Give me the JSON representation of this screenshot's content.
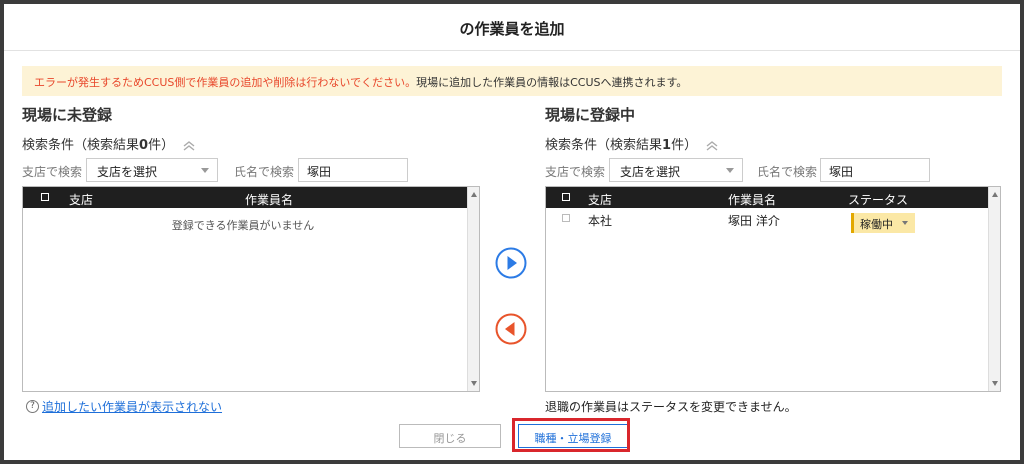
{
  "modal": {
    "title": "の作業員を追加",
    "warning_red": "エラーが発生するためCCUS側で作業員の追加や削除は行わないでください。",
    "warning_normal": "現場に追加した作業員の情報はCCUSへ連携されます。"
  },
  "left": {
    "title": "現場に未登録",
    "condition_prefix": "検索条件（検索結果",
    "condition_count": "0",
    "condition_suffix": "件）",
    "branch_label": "支店で検索",
    "branch_select": "支店を選択",
    "name_label": "氏名で検索",
    "name_value": "塚田",
    "columns": {
      "branch": "支店",
      "worker": "作業員名"
    },
    "empty_message": "登録できる作業員がいません",
    "help_link": "追加したい作業員が表示されない"
  },
  "right": {
    "title": "現場に登録中",
    "condition_prefix": "検索条件（検索結果",
    "condition_count": "1",
    "condition_suffix": "件）",
    "branch_label": "支店で検索",
    "branch_select": "支店を選択",
    "name_label": "氏名で検索",
    "name_value": "塚田",
    "columns": {
      "branch": "支店",
      "worker": "作業員名",
      "status": "ステータス"
    },
    "rows": [
      {
        "branch": "本社",
        "worker": "塚田 洋介",
        "status": "稼働中"
      }
    ],
    "note": "退職の作業員はステータスを変更できません。"
  },
  "buttons": {
    "close": "閉じる",
    "register": "職種・立場登録"
  },
  "icons": {
    "move_right": "arrow-right-circle-icon",
    "move_left": "arrow-left-circle-icon",
    "collapse": "double-chevron-up-icon",
    "help": "question-circle-icon"
  },
  "colors": {
    "blue": "#2c7be5",
    "orange": "#e8542b",
    "warning_bg": "#fdf3d6",
    "highlight": "#d9262c"
  }
}
